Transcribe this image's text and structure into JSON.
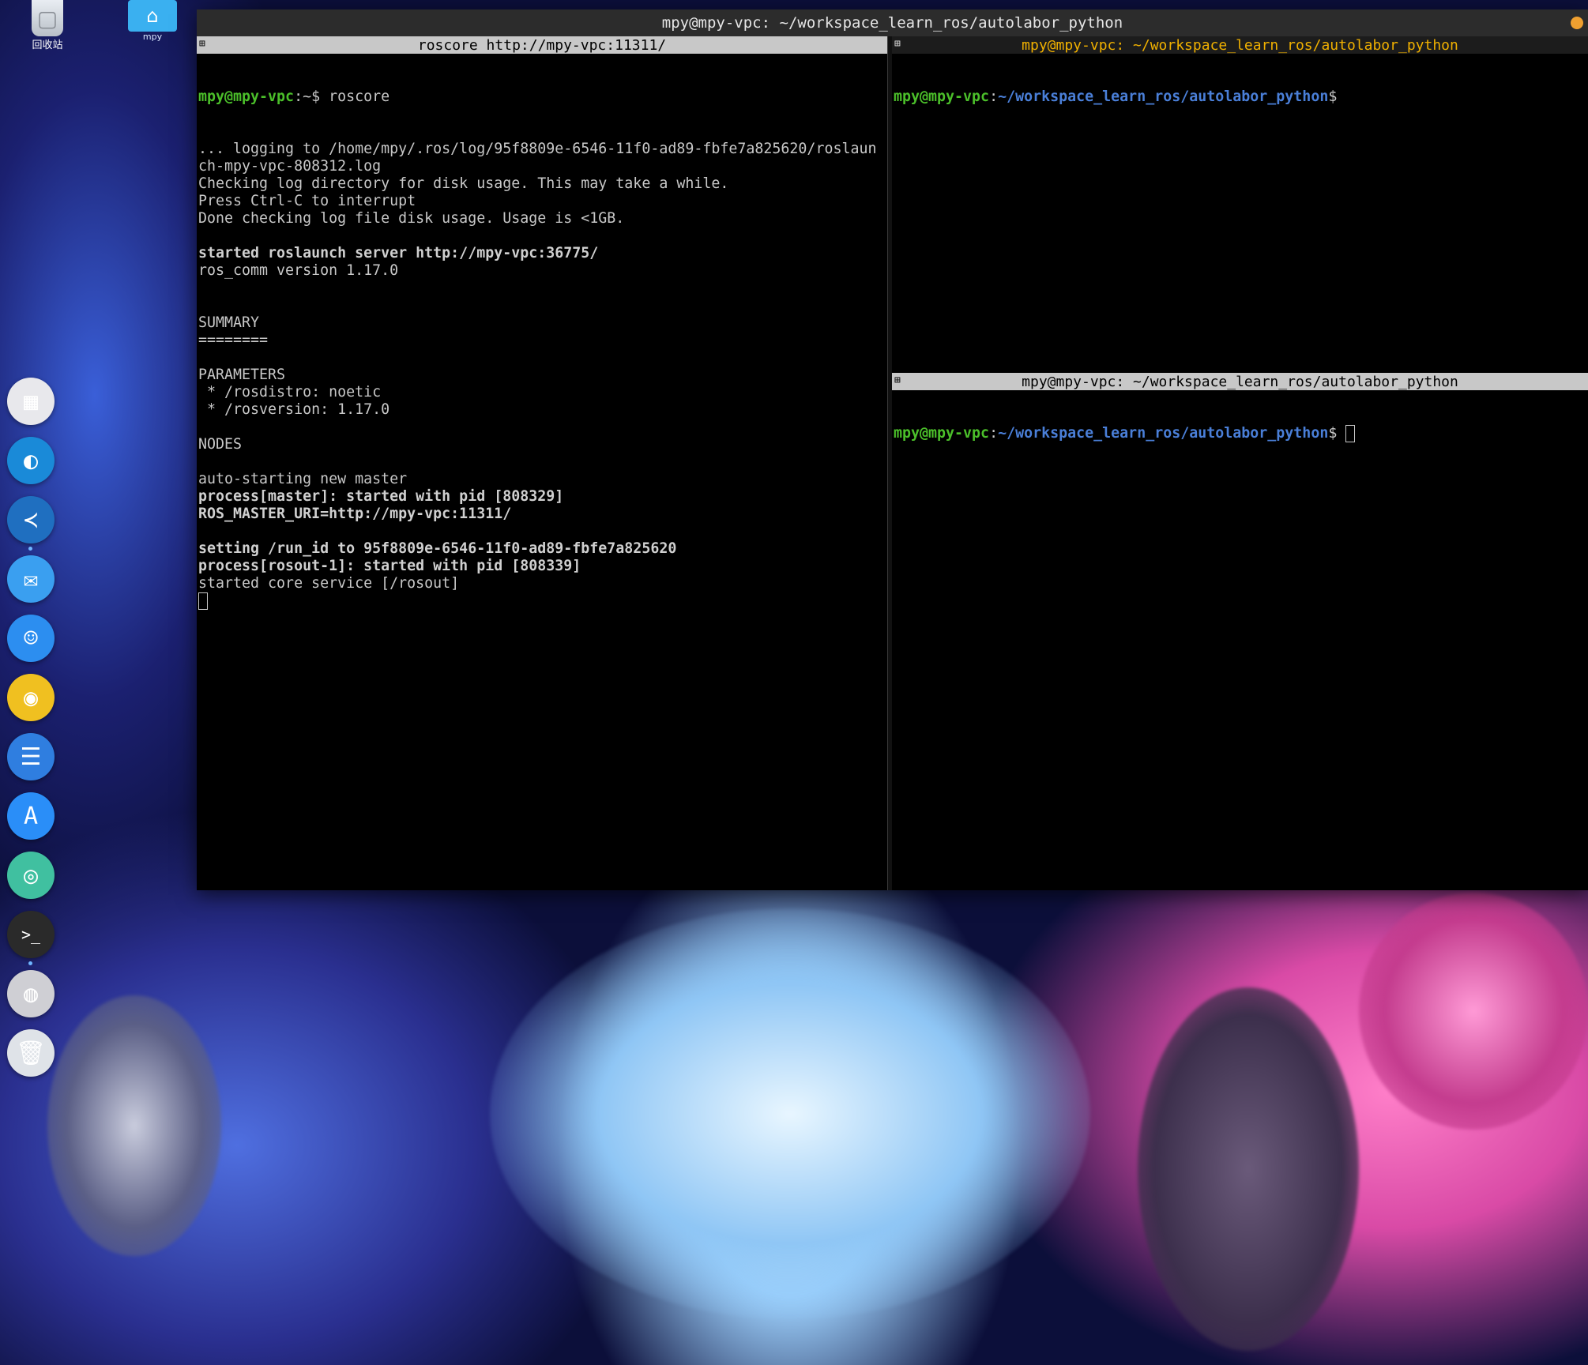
{
  "desktop": {
    "icons": [
      {
        "label": "回收站"
      },
      {
        "label": "mpy"
      }
    ]
  },
  "dock": {
    "items": [
      {
        "name": "launcher",
        "glyph": "▦",
        "color": "#e8e8ec"
      },
      {
        "name": "edge-browser",
        "glyph": "◐",
        "color": "#1a8ad8"
      },
      {
        "name": "vscode",
        "glyph": "≺",
        "color": "#1f6fc0"
      },
      {
        "name": "mail",
        "glyph": "✉",
        "color": "#3a9ff0"
      },
      {
        "name": "finder",
        "glyph": "☺",
        "color": "#2c8ef0"
      },
      {
        "name": "music",
        "glyph": "◉",
        "color": "#f0c020"
      },
      {
        "name": "writer",
        "glyph": "☰",
        "color": "#2f7ee0"
      },
      {
        "name": "app-store",
        "glyph": "A",
        "color": "#2a8ef8"
      },
      {
        "name": "help",
        "glyph": "◎",
        "color": "#40c0a0"
      },
      {
        "name": "terminal",
        "glyph": ">_",
        "color": "#2a2a2a"
      },
      {
        "name": "disc",
        "glyph": "◍",
        "color": "#cfcfd4"
      },
      {
        "name": "trash",
        "glyph": "🗑",
        "color": "#dfe3e8"
      }
    ]
  },
  "window": {
    "title": "mpy@mpy-vpc: ~/workspace_learn_ros/autolabor_python",
    "left_pane": {
      "bar_title": "roscore http://mpy-vpc:11311/",
      "prompt_user": "mpy@mpy-vpc",
      "prompt_path": ":~$ ",
      "command": "roscore",
      "lines": [
        {
          "text": "... logging to /home/mpy/.ros/log/95f8809e-6546-11f0-ad89-fbfe7a825620/roslaun",
          "bold": false
        },
        {
          "text": "ch-mpy-vpc-808312.log",
          "bold": false
        },
        {
          "text": "Checking log directory for disk usage. This may take a while.",
          "bold": false
        },
        {
          "text": "Press Ctrl-C to interrupt",
          "bold": false
        },
        {
          "text": "Done checking log file disk usage. Usage is <1GB.",
          "bold": false
        },
        {
          "text": "",
          "bold": false
        },
        {
          "text": "started roslaunch server http://mpy-vpc:36775/",
          "bold": true
        },
        {
          "text": "ros_comm version 1.17.0",
          "bold": false
        },
        {
          "text": "",
          "bold": false
        },
        {
          "text": "",
          "bold": false
        },
        {
          "text": "SUMMARY",
          "bold": false
        },
        {
          "text": "========",
          "bold": false
        },
        {
          "text": "",
          "bold": false
        },
        {
          "text": "PARAMETERS",
          "bold": false
        },
        {
          "text": " * /rosdistro: noetic",
          "bold": false
        },
        {
          "text": " * /rosversion: 1.17.0",
          "bold": false
        },
        {
          "text": "",
          "bold": false
        },
        {
          "text": "NODES",
          "bold": false
        },
        {
          "text": "",
          "bold": false
        },
        {
          "text": "auto-starting new master",
          "bold": false
        },
        {
          "text": "process[master]: started with pid [808329]",
          "bold": true
        },
        {
          "text": "ROS_MASTER_URI=http://mpy-vpc:11311/",
          "bold": true
        },
        {
          "text": "",
          "bold": false
        },
        {
          "text": "setting /run_id to 95f8809e-6546-11f0-ad89-fbfe7a825620",
          "bold": true
        },
        {
          "text": "process[rosout-1]: started with pid [808339]",
          "bold": true
        },
        {
          "text": "started core service [/rosout]",
          "bold": false
        }
      ]
    },
    "top_right_pane": {
      "bar_title": "mpy@mpy-vpc: ~/workspace_learn_ros/autolabor_python",
      "prompt_user": "mpy@mpy-vpc",
      "prompt_colon": ":",
      "prompt_path": "~/workspace_learn_ros/autolabor_python",
      "prompt_end": "$"
    },
    "bottom_right_pane": {
      "bar_title": "mpy@mpy-vpc: ~/workspace_learn_ros/autolabor_python",
      "prompt_user": "mpy@mpy-vpc",
      "prompt_colon": ":",
      "prompt_path": "~/workspace_learn_ros/autolabor_python",
      "prompt_end": "$ "
    }
  }
}
